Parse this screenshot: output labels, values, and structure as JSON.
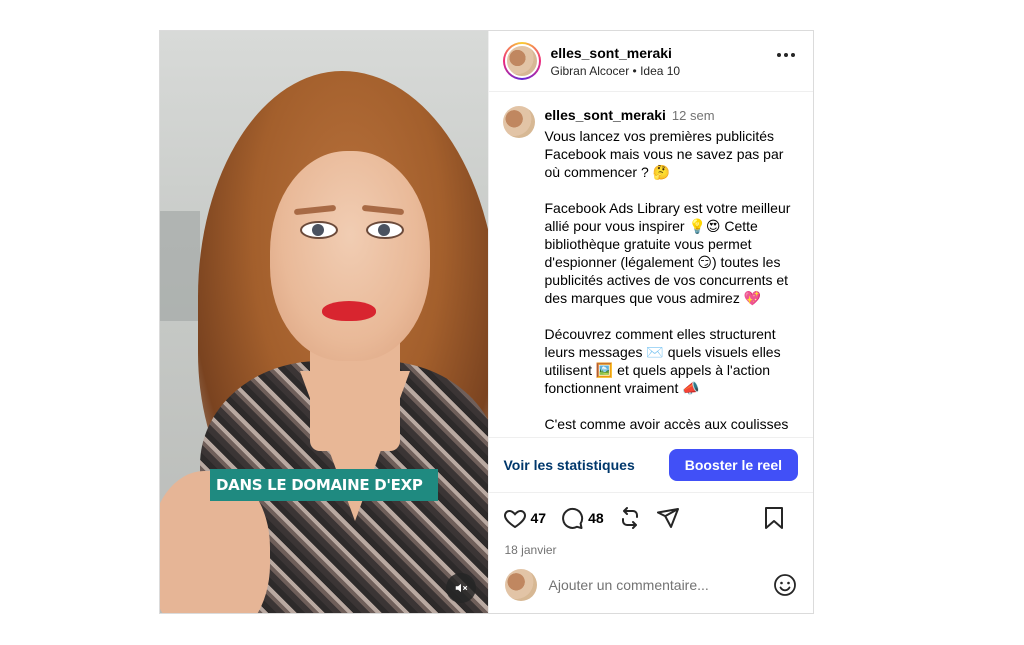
{
  "media": {
    "caption_overlay": "DANS LE DOMAINE D'EXP",
    "mute_icon": "muted-speaker-icon"
  },
  "header": {
    "username": "elles_sont_meraki",
    "subtitle": "Gibran Alcocer • Idea 10",
    "more_icon": "more-horizontal-icon"
  },
  "caption": {
    "username": "elles_sont_meraki",
    "time": "12 sem",
    "paragraphs": [
      "Vous lancez vos premières publicités Facebook mais vous ne savez pas par où commencer ? 🤔",
      "Facebook Ads Library est votre meilleur allié pour vous inspirer 💡😍 Cette bibliothèque gratuite vous permet d'espionner (légalement 😏) toutes les publicités actives de vos concurrents et des marques que vous admirez 💖",
      "Découvrez comment elles structurent leurs messages ✉️ quels visuels elles utilisent 🖼️ et quels appels à l'action fonctionnent vraiment 📣",
      "C'est comme avoir accès aux coulisses"
    ]
  },
  "actions": {
    "stats_label": "Voir les statistiques",
    "boost_label": "Booster le reel"
  },
  "engagement": {
    "likes": "47",
    "comments": "48",
    "date": "18 janvier"
  },
  "comment": {
    "placeholder": "Ajouter un commentaire...",
    "emoji_icon": "emoji-smile-icon"
  },
  "colors": {
    "boost_button": "#4150f7",
    "stats_link": "#00376b",
    "caption_overlay_bg": "#1f8a80"
  }
}
